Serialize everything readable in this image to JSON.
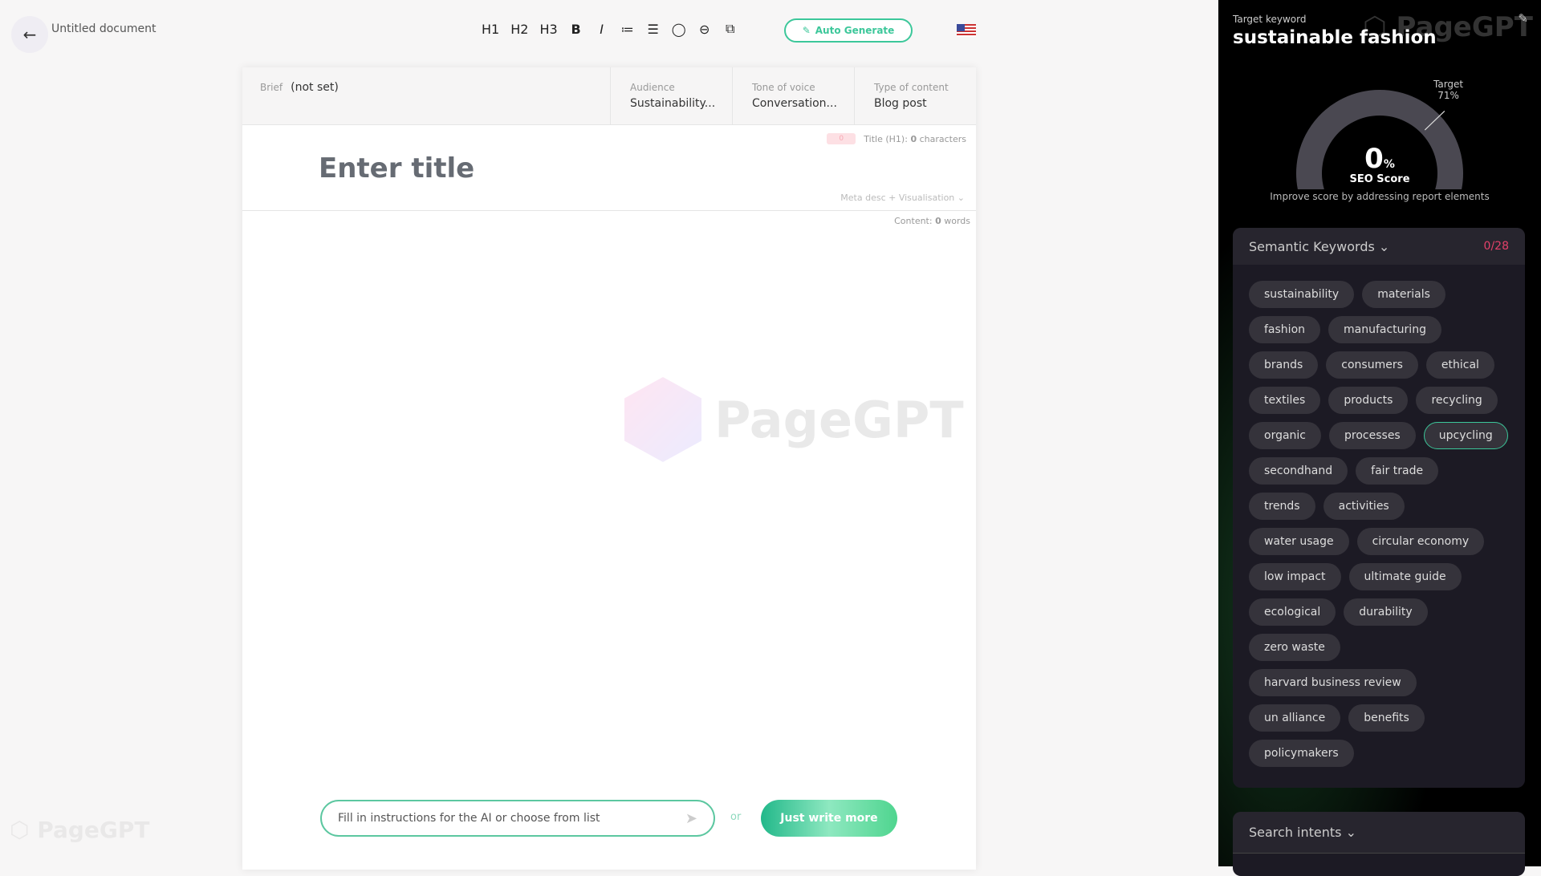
{
  "header": {
    "title": "Untitled document",
    "toolbar": [
      "H1",
      "H2",
      "H3",
      "B",
      "I",
      "≔",
      "☰",
      "◯",
      "⊖",
      "⧉"
    ],
    "auto_generate": "Auto Generate",
    "language": "en-US"
  },
  "brief": {
    "label": "Brief",
    "value": "(not set)",
    "fields": [
      {
        "label": "Audience",
        "value": "Sustainability..."
      },
      {
        "label": "Tone of voice",
        "value": "Conversation..."
      },
      {
        "label": "Type of content",
        "value": "Blog post"
      }
    ]
  },
  "title": {
    "count_badge": "0",
    "count_prefix": "Title (H1): ",
    "count_value": "0",
    "count_suffix": " characters",
    "placeholder": "Enter title",
    "meta_toggle": "Meta desc + Visualisation ⌄"
  },
  "content": {
    "prefix": "Content: ",
    "value": "0",
    "suffix": " words"
  },
  "prompt": {
    "placeholder": "Fill in instructions for the AI or choose from list",
    "or": "or",
    "just_write": "Just write more"
  },
  "watermark": "PageGPT",
  "panel": {
    "target_label": "Target keyword",
    "target_keyword": "sustainable fashion",
    "score": 0,
    "score_text": "0",
    "score_unit": "%",
    "score_label": "SEO Score",
    "target_text": "Target",
    "target_pct_text": "71%",
    "target_pct": 71,
    "hint": "Improve score by addressing report elements",
    "semantic": {
      "title": "Semantic Keywords ⌄",
      "count": "0/28",
      "selected": "upcycling",
      "rows": [
        [
          "sustainability",
          "materials"
        ],
        [
          "fashion",
          "manufacturing"
        ],
        [
          "brands",
          "consumers",
          "ethical"
        ],
        [
          "textiles",
          "products",
          "recycling"
        ],
        [
          "organic",
          "processes",
          "upcycling"
        ],
        [
          "secondhand",
          "fair trade"
        ],
        [
          "trends",
          "activities"
        ],
        [
          "water usage",
          "circular economy"
        ],
        [
          "low impact",
          "ultimate guide"
        ],
        [
          "ecological",
          "durability"
        ],
        [
          "zero waste"
        ],
        [
          "harvard business review"
        ],
        [
          "un alliance",
          "benefits"
        ],
        [
          "policymakers"
        ]
      ]
    },
    "search_intents": "Search intents ⌄"
  },
  "colors": {
    "accent": "#3cc79a",
    "count_red": "#e4416a",
    "gauge_track": "#4a4851"
  }
}
